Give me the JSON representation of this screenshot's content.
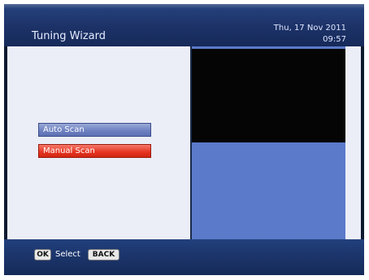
{
  "header": {
    "title": "Tuning Wizard",
    "date": "Thu, 17 Nov 2011",
    "time": "09:57"
  },
  "menu": {
    "items": [
      {
        "label": "Auto Scan",
        "selected": false
      },
      {
        "label": "Manual Scan",
        "selected": true
      }
    ]
  },
  "footer": {
    "ok_key": "OK",
    "ok_action": "Select",
    "back_key": "BACK"
  },
  "colors": {
    "header_bar": "#1c3267",
    "selected_item": "#e5331f",
    "unselected_item": "#6b7fc0",
    "preview_panel": "#5b7ac9"
  }
}
